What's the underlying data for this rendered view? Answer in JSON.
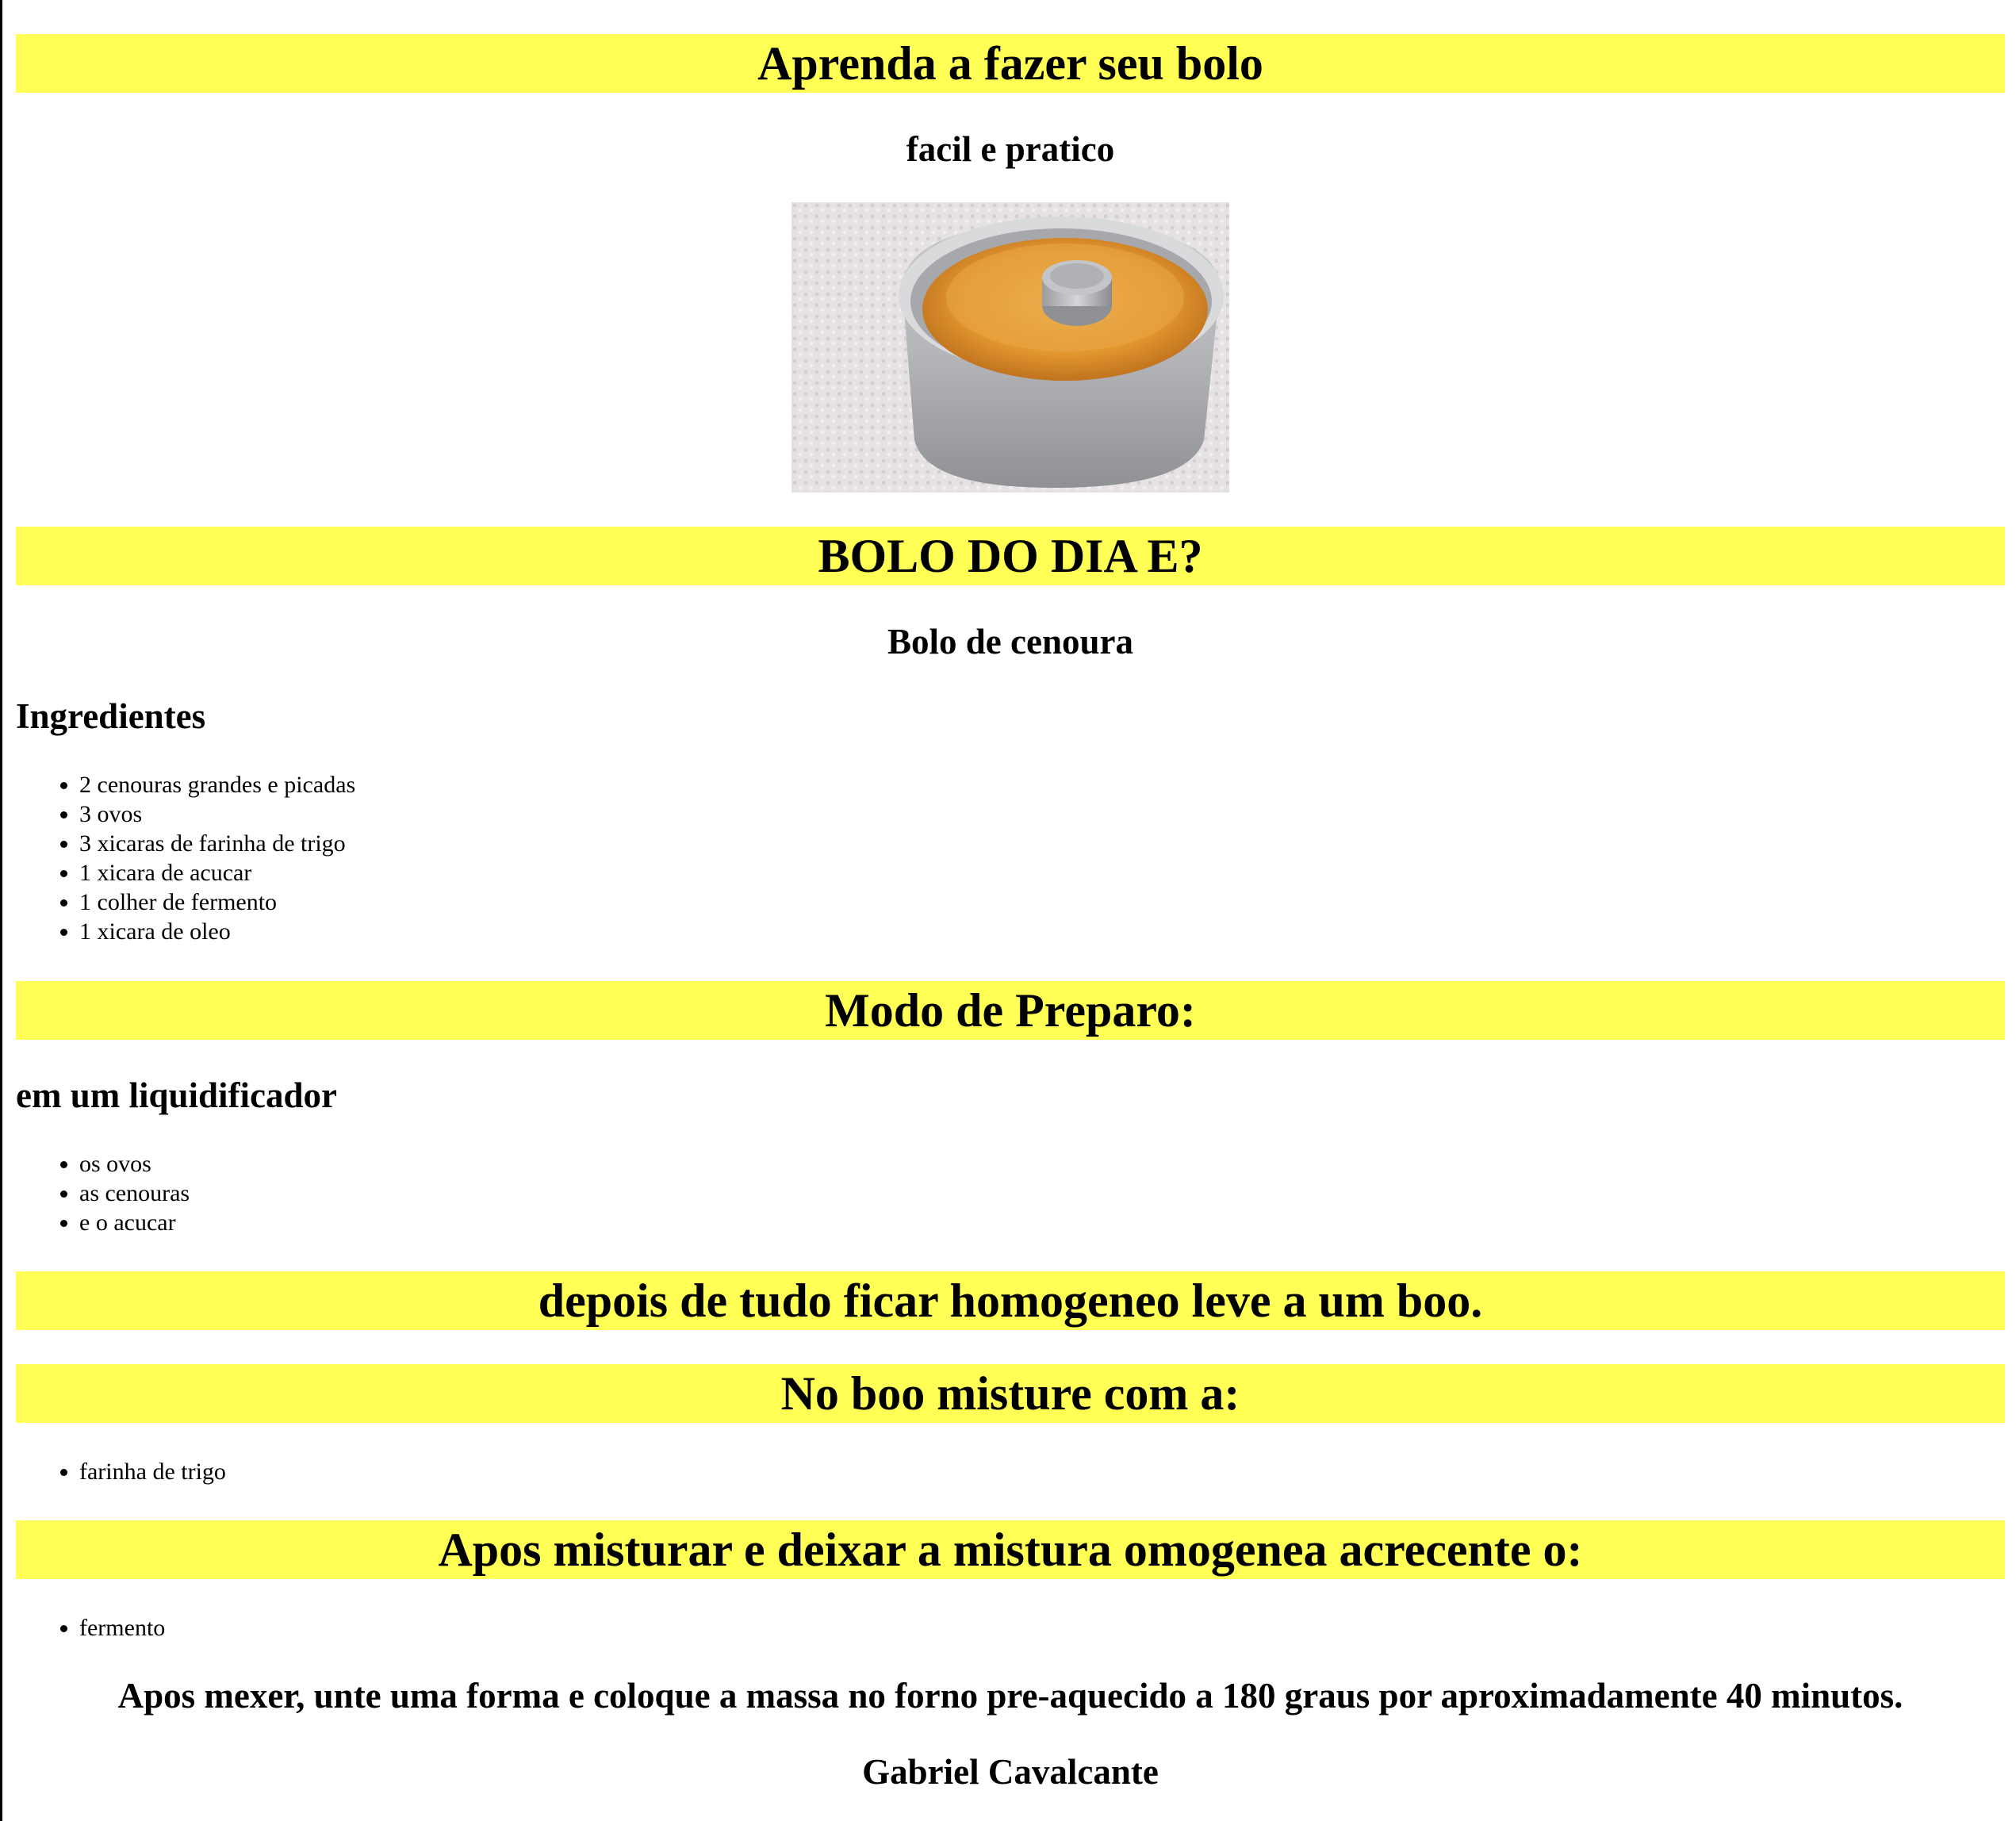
{
  "header": {
    "title": "Aprenda a fazer seu bolo",
    "subtitle": "facil e pratico"
  },
  "image": {
    "icon": "cake-photo"
  },
  "day": {
    "banner": "BOLO DO DIA E?",
    "name": "Bolo de cenoura"
  },
  "ingredients": {
    "heading": "Ingredientes",
    "items": [
      "2 cenouras grandes e picadas",
      "3 ovos",
      "3 xicaras de farinha de trigo",
      "1 xicara de acucar",
      "1 colher de fermento",
      "1 xicara de oleo"
    ]
  },
  "preparo": {
    "banner": "Modo de Preparo:",
    "subheading": "em um liquidificador",
    "items": [
      "os ovos",
      "as cenouras",
      "e o acucar"
    ]
  },
  "step2": {
    "banner": "depois de tudo ficar homogeneo leve a um boo."
  },
  "step3": {
    "banner": "No boo misture com a:",
    "items": [
      "farinha de trigo"
    ]
  },
  "step4": {
    "banner": "Apos misturar e deixar a mistura omogenea acrecente o:",
    "items": [
      "fermento"
    ]
  },
  "final": {
    "instruction": "Apos mexer, unte uma forma e coloque a massa no forno pre-aquecido a 180 graus por aproximadamente 40 minutos.",
    "author": "Gabriel Cavalcante"
  },
  "colors": {
    "banner_bg": "#ffff55",
    "text": "#000000",
    "background": "#ffffff"
  }
}
